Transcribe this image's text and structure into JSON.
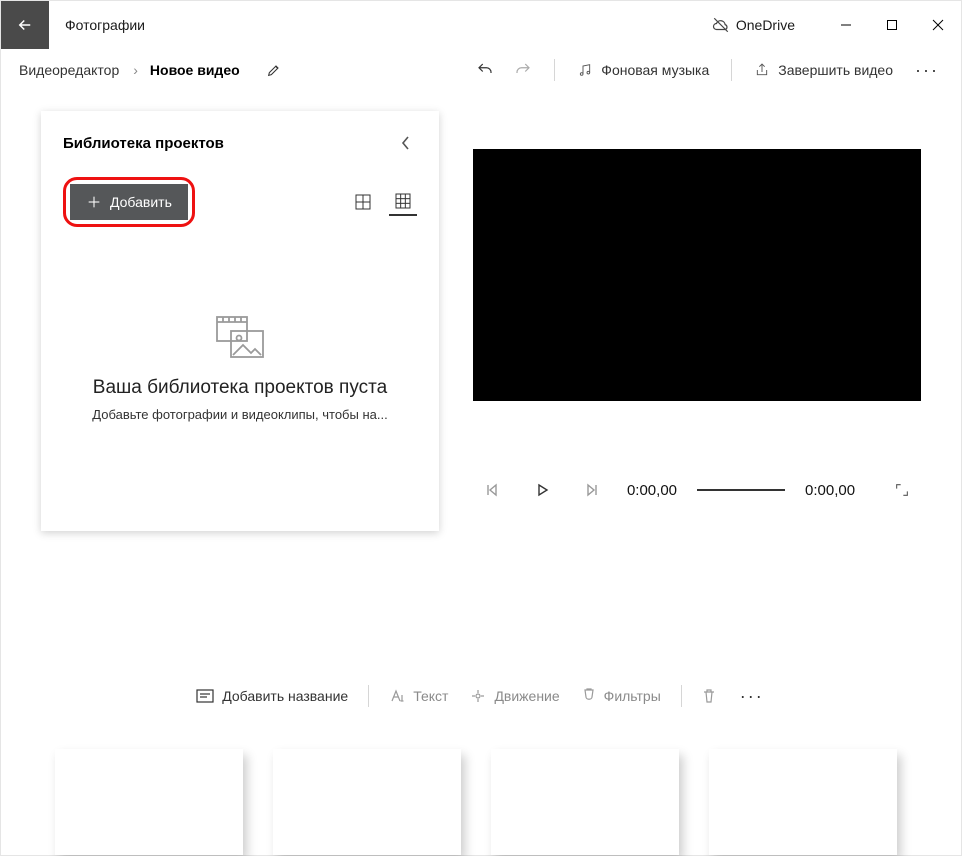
{
  "titlebar": {
    "app_name": "Фотографии",
    "onedrive": "OneDrive"
  },
  "toolbar": {
    "breadcrumb": "Видеоредактор",
    "project_name": "Новое видео",
    "bg_music": "Фоновая музыка",
    "finish": "Завершить видео"
  },
  "library": {
    "title": "Библиотека проектов",
    "add_label": "Добавить",
    "empty_heading": "Ваша библиотека проектов пуста",
    "empty_sub": "Добавьте фотографии и видеоклипы, чтобы на..."
  },
  "player": {
    "current": "0:00,00",
    "total": "0:00,00"
  },
  "storyboard": {
    "add_title": "Добавить название",
    "text": "Текст",
    "motion": "Движение",
    "filters": "Фильтры"
  }
}
